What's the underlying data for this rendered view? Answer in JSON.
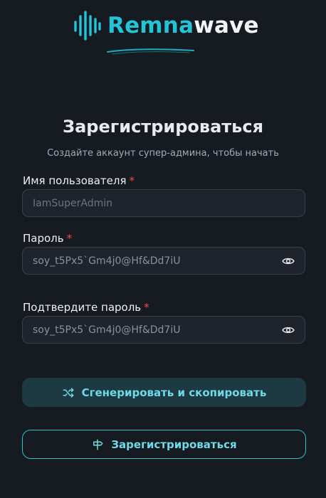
{
  "brand": {
    "name_part1": "Remna",
    "name_part2": "wave",
    "accent_color": "#22c4d6",
    "icon": "soundwave-icon"
  },
  "form": {
    "title": "Зарегистрироваться",
    "subtitle": "Создайте аккаунт супер-админа, чтобы начать",
    "username": {
      "label": "Имя пользователя",
      "required_mark": "*",
      "placeholder": "IamSuperAdmin"
    },
    "password": {
      "label": "Пароль",
      "required_mark": "*",
      "value": "soy_t5Px5`Gm4j0@Hf&Dd7iU",
      "toggle_icon": "eye-icon"
    },
    "confirm_password": {
      "label": "Подтвердите пароль",
      "required_mark": "*",
      "value": "soy_t5Px5`Gm4j0@Hf&Dd7iU",
      "toggle_icon": "eye-icon"
    },
    "generate_button": {
      "label": "Сгенерировать и скопировать",
      "icon": "shuffle-icon"
    },
    "register_button": {
      "label": "Зарегистрироваться",
      "icon": "signpost-icon"
    }
  }
}
